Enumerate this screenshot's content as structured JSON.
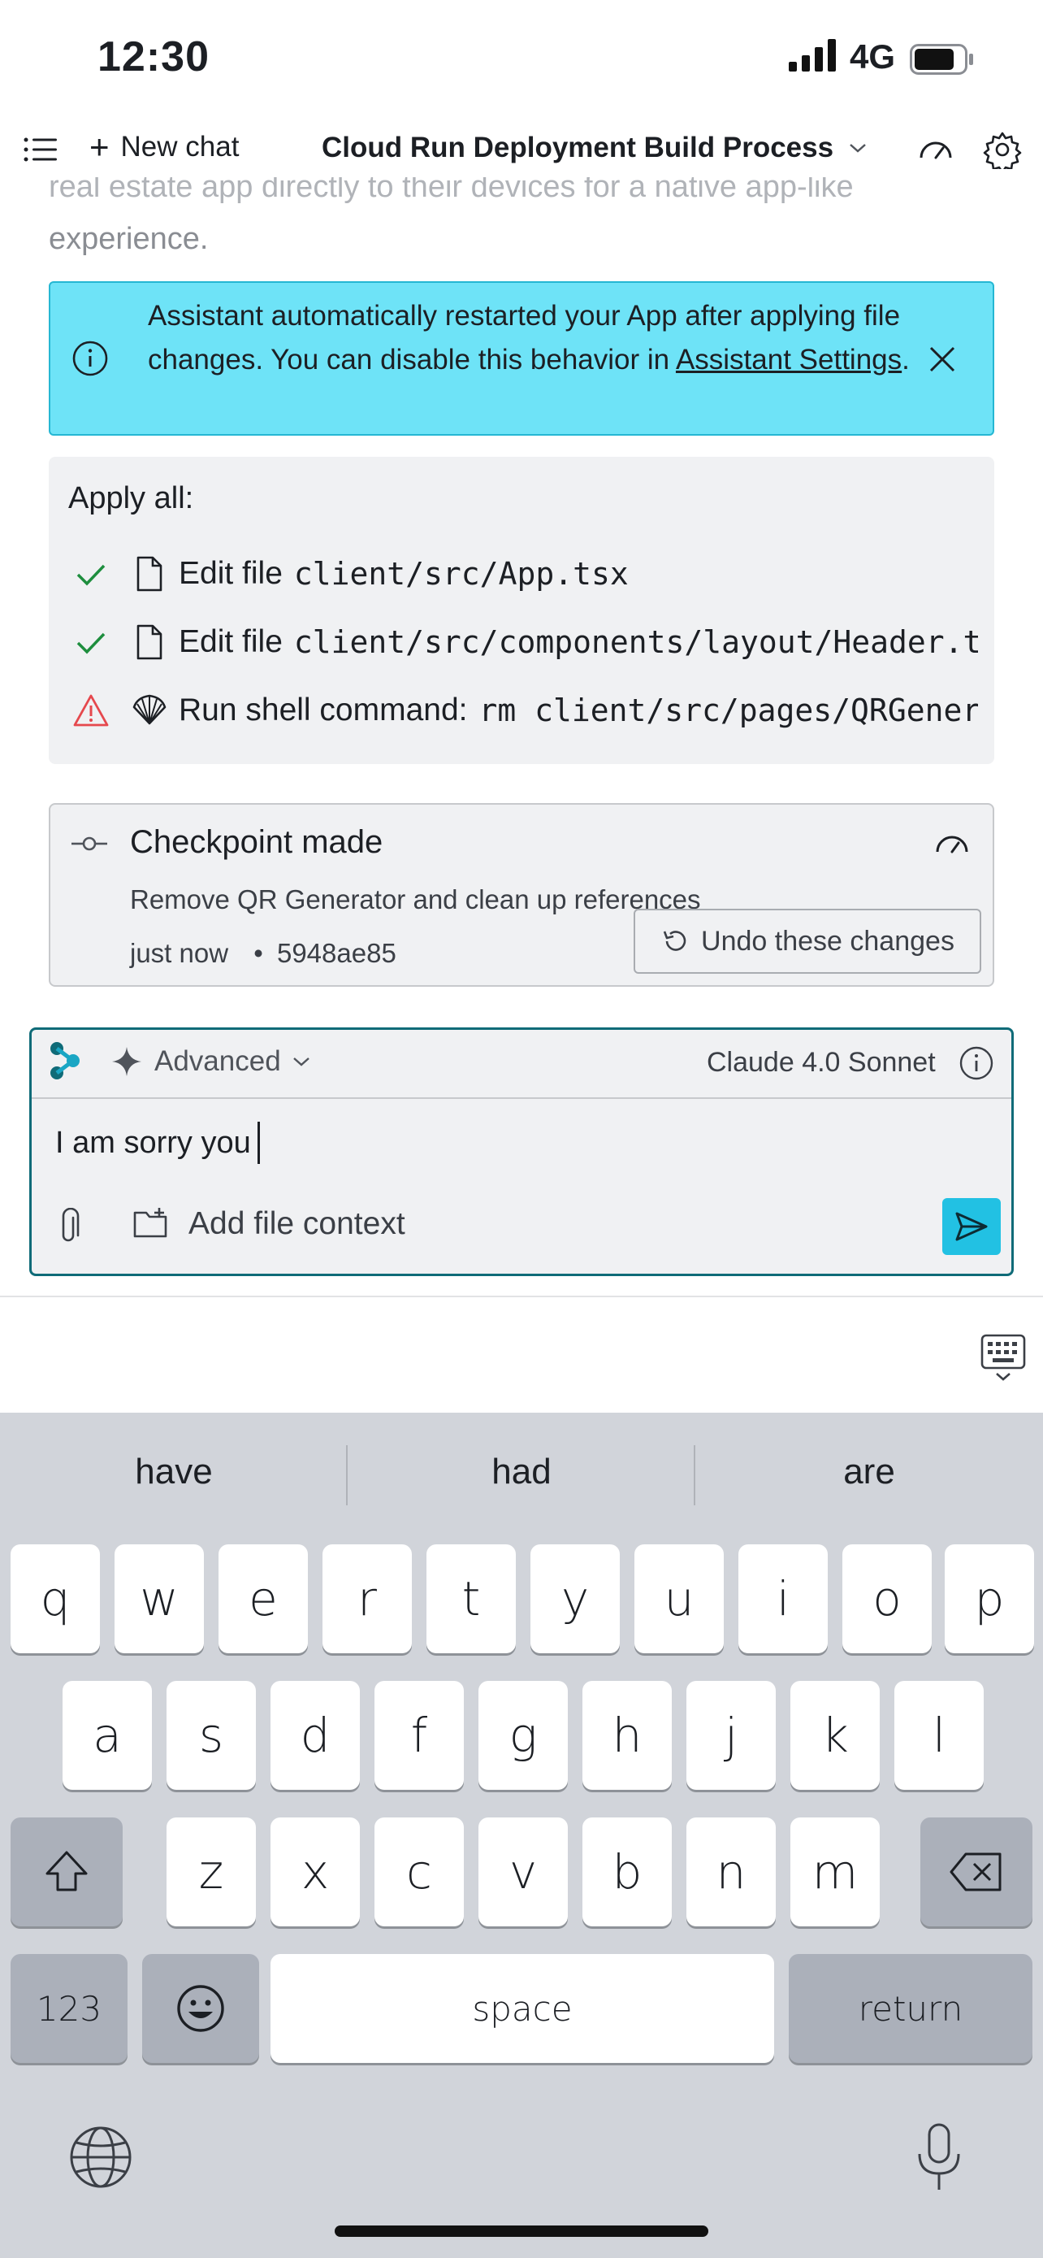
{
  "status_bar": {
    "time": "12:30",
    "network": "4G"
  },
  "header": {
    "new_chat_label": "New chat",
    "title": "Cloud Run Deployment Build Process"
  },
  "previous_message": {
    "line1": "real estate app directly to their devices for a native app-like",
    "line2": "experience."
  },
  "banner": {
    "text_part1": "Assistant automatically restarted your App after applying file changes. You can disable this behavior in ",
    "link_text": "Assistant Settings",
    "text_part2": "."
  },
  "apply_all": {
    "title": "Apply all:",
    "items": [
      {
        "status": "success",
        "icon": "file-icon",
        "label": "Edit file",
        "code": "client/src/App.tsx"
      },
      {
        "status": "success",
        "icon": "file-icon",
        "label": "Edit file",
        "code": "client/src/components/layout/Header.tsx"
      },
      {
        "status": "warning",
        "icon": "shell-icon",
        "label": "Run shell command:",
        "code": "rm client/src/pages/QRGenerator.tsx"
      }
    ]
  },
  "checkpoint": {
    "title": "Checkpoint made",
    "description": "Remove QR Generator and clean up references",
    "time": "just now",
    "commit": "5948ae85",
    "undo_label": "Undo these changes"
  },
  "composer": {
    "mode": "Advanced",
    "model": "Claude 4.0 Sonnet",
    "input_value": "I am sorry you",
    "add_file_context_label": "Add file context"
  },
  "keyboard": {
    "suggestions": [
      "have",
      "had",
      "are"
    ],
    "row1": [
      "q",
      "w",
      "e",
      "r",
      "t",
      "y",
      "u",
      "i",
      "o",
      "p"
    ],
    "row2": [
      "a",
      "s",
      "d",
      "f",
      "g",
      "h",
      "j",
      "k",
      "l"
    ],
    "row3": [
      "z",
      "x",
      "c",
      "v",
      "b",
      "n",
      "m"
    ],
    "numbers_label": "123",
    "space_label": "space",
    "return_label": "return"
  },
  "colors": {
    "banner_bg": "#6ee3f7",
    "accent": "#22c1e3",
    "composer_border": "#0f6b78",
    "success": "#1e8e3e",
    "warning": "#e5484d"
  }
}
